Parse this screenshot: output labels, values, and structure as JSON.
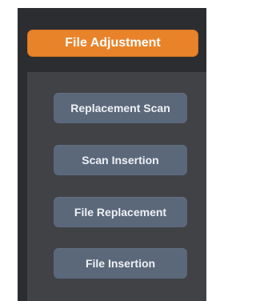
{
  "header": {
    "title": "File Adjustment",
    "accent_color": "#e9832a"
  },
  "actions": [
    {
      "label": "Replacement Scan"
    },
    {
      "label": "Scan Insertion"
    },
    {
      "label": "File Replacement"
    },
    {
      "label": "File Insertion"
    }
  ],
  "colors": {
    "frame_bg": "#2b2d30",
    "panel_bg": "#404246",
    "button_bg": "#5b687a",
    "button_text": "#eef1f6"
  }
}
